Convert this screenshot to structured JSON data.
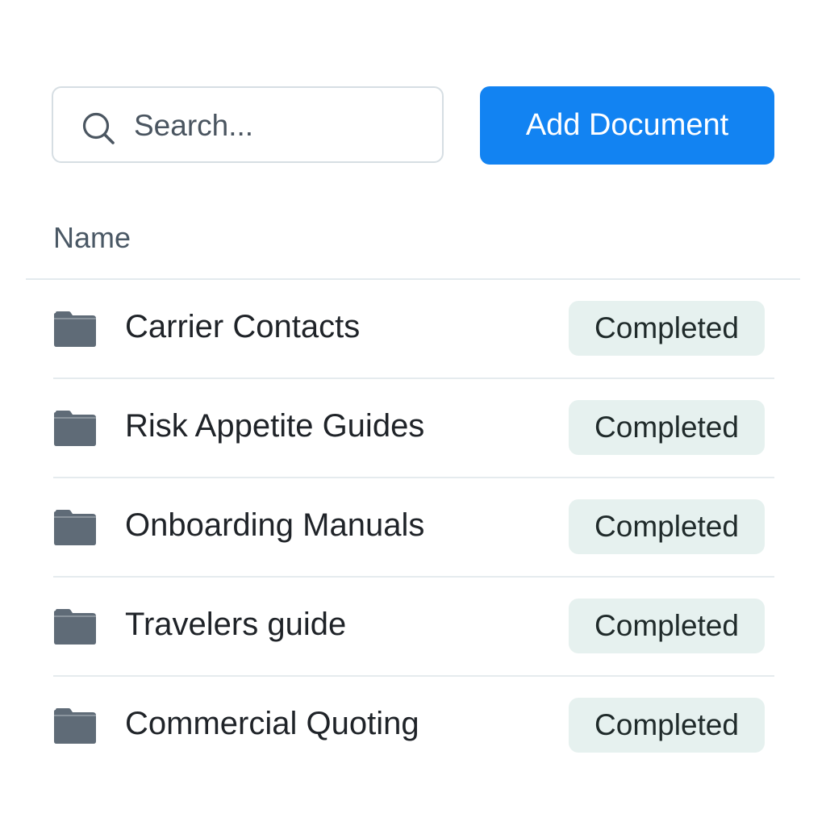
{
  "search": {
    "placeholder": "Search...",
    "value": "",
    "icon": "search-icon"
  },
  "toolbar": {
    "add_label": "Add Document",
    "accent_color": "#1283f2"
  },
  "table": {
    "columns": [
      "Name"
    ],
    "rows": [
      {
        "name": "Carrier Contacts",
        "status": "Completed",
        "icon": "folder-icon"
      },
      {
        "name": "Risk Appetite Guides",
        "status": "Completed",
        "icon": "folder-icon"
      },
      {
        "name": "Onboarding Manuals",
        "status": "Completed",
        "icon": "folder-icon"
      },
      {
        "name": "Travelers guide",
        "status": "Completed",
        "icon": "folder-icon"
      },
      {
        "name": "Commercial Quoting",
        "status": "Completed",
        "icon": "folder-icon"
      }
    ],
    "status_badge_color": "#e6f1ef"
  }
}
